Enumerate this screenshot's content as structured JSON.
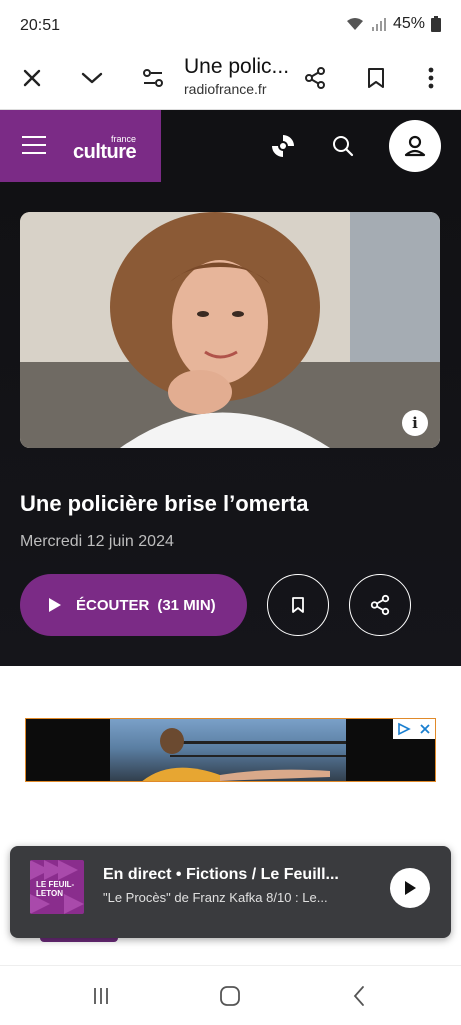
{
  "status": {
    "time": "20:51",
    "battery": "45%"
  },
  "browser": {
    "page_title": "Une polic...",
    "domain": "radiofrance.fr",
    "icons": [
      "close-icon",
      "chevron-down-icon",
      "page-settings-icon",
      "share-icon",
      "bookmark-icon",
      "more-icon"
    ]
  },
  "site": {
    "logo_small": "france",
    "logo_big": "culture",
    "brand_color": "#7b2b86"
  },
  "article": {
    "title": "Une policière brise l’omerta",
    "date": "Mercredi 12 juin 2024",
    "listen_label": "ÉCOUTER",
    "duration": "(31 MIN)",
    "image_info": "i"
  },
  "player": {
    "thumb_label": "LE FEUIL-LETON",
    "line1": "En direct • Fictions / Le Feuill...",
    "line2": "\"Le Procès\" de Franz Kafka 8/10 : Le..."
  }
}
